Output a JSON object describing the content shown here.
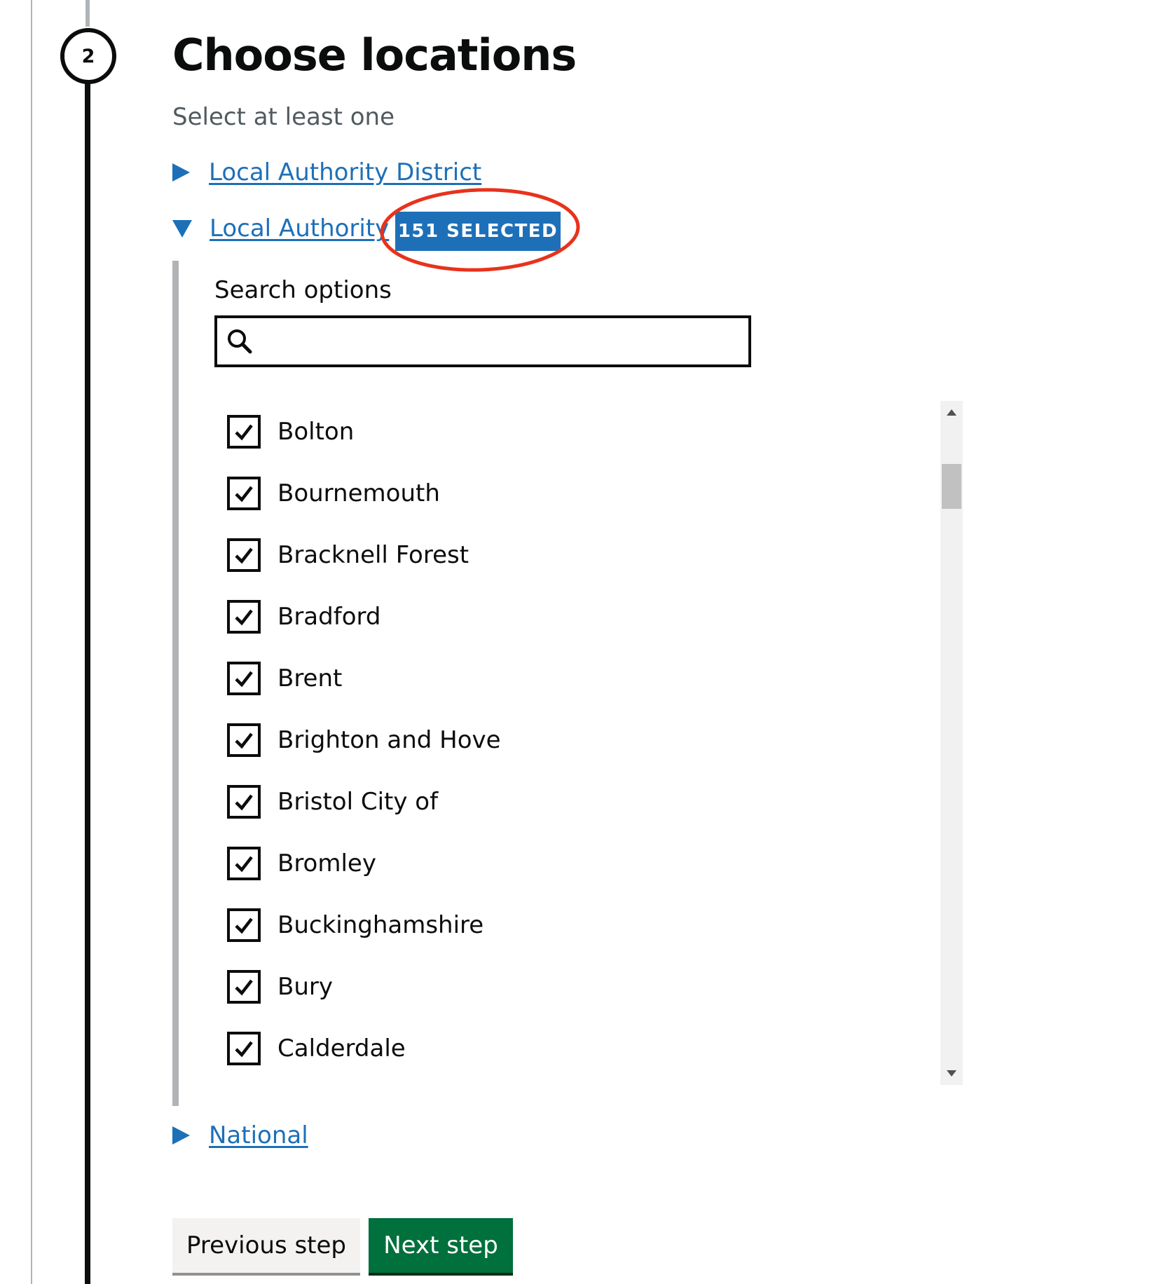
{
  "step": {
    "number": "2",
    "title": "Choose locations",
    "hint": "Select at least one"
  },
  "groups": [
    {
      "label": "Local Authority District",
      "expanded": false
    },
    {
      "label": "Local Authority",
      "expanded": true,
      "badge": "151 SELECTED"
    },
    {
      "label": "National",
      "expanded": false
    }
  ],
  "search": {
    "label": "Search options",
    "value": "",
    "placeholder": ""
  },
  "options": [
    {
      "label": "Bolton",
      "checked": true
    },
    {
      "label": "Bournemouth",
      "checked": true
    },
    {
      "label": "Bracknell Forest",
      "checked": true
    },
    {
      "label": "Bradford",
      "checked": true
    },
    {
      "label": "Brent",
      "checked": true
    },
    {
      "label": "Brighton and Hove",
      "checked": true
    },
    {
      "label": "Bristol City of",
      "checked": true
    },
    {
      "label": "Bromley",
      "checked": true
    },
    {
      "label": "Buckinghamshire",
      "checked": true
    },
    {
      "label": "Bury",
      "checked": true
    },
    {
      "label": "Calderdale",
      "checked": true
    }
  ],
  "buttons": {
    "previous": "Previous step",
    "next": "Next step"
  },
  "colors": {
    "link": "#1d70b8",
    "badge": "#1d70b8",
    "primary_button": "#00703c",
    "highlight": "#e8321c"
  }
}
